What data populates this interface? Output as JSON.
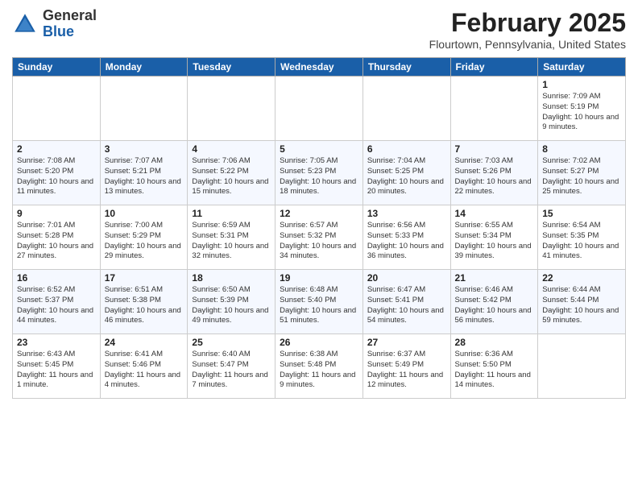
{
  "header": {
    "logo_general": "General",
    "logo_blue": "Blue",
    "month_title": "February 2025",
    "location": "Flourtown, Pennsylvania, United States"
  },
  "days_of_week": [
    "Sunday",
    "Monday",
    "Tuesday",
    "Wednesday",
    "Thursday",
    "Friday",
    "Saturday"
  ],
  "weeks": [
    [
      {
        "day": "",
        "info": ""
      },
      {
        "day": "",
        "info": ""
      },
      {
        "day": "",
        "info": ""
      },
      {
        "day": "",
        "info": ""
      },
      {
        "day": "",
        "info": ""
      },
      {
        "day": "",
        "info": ""
      },
      {
        "day": "1",
        "info": "Sunrise: 7:09 AM\nSunset: 5:19 PM\nDaylight: 10 hours and 9 minutes."
      }
    ],
    [
      {
        "day": "2",
        "info": "Sunrise: 7:08 AM\nSunset: 5:20 PM\nDaylight: 10 hours and 11 minutes."
      },
      {
        "day": "3",
        "info": "Sunrise: 7:07 AM\nSunset: 5:21 PM\nDaylight: 10 hours and 13 minutes."
      },
      {
        "day": "4",
        "info": "Sunrise: 7:06 AM\nSunset: 5:22 PM\nDaylight: 10 hours and 15 minutes."
      },
      {
        "day": "5",
        "info": "Sunrise: 7:05 AM\nSunset: 5:23 PM\nDaylight: 10 hours and 18 minutes."
      },
      {
        "day": "6",
        "info": "Sunrise: 7:04 AM\nSunset: 5:25 PM\nDaylight: 10 hours and 20 minutes."
      },
      {
        "day": "7",
        "info": "Sunrise: 7:03 AM\nSunset: 5:26 PM\nDaylight: 10 hours and 22 minutes."
      },
      {
        "day": "8",
        "info": "Sunrise: 7:02 AM\nSunset: 5:27 PM\nDaylight: 10 hours and 25 minutes."
      }
    ],
    [
      {
        "day": "9",
        "info": "Sunrise: 7:01 AM\nSunset: 5:28 PM\nDaylight: 10 hours and 27 minutes."
      },
      {
        "day": "10",
        "info": "Sunrise: 7:00 AM\nSunset: 5:29 PM\nDaylight: 10 hours and 29 minutes."
      },
      {
        "day": "11",
        "info": "Sunrise: 6:59 AM\nSunset: 5:31 PM\nDaylight: 10 hours and 32 minutes."
      },
      {
        "day": "12",
        "info": "Sunrise: 6:57 AM\nSunset: 5:32 PM\nDaylight: 10 hours and 34 minutes."
      },
      {
        "day": "13",
        "info": "Sunrise: 6:56 AM\nSunset: 5:33 PM\nDaylight: 10 hours and 36 minutes."
      },
      {
        "day": "14",
        "info": "Sunrise: 6:55 AM\nSunset: 5:34 PM\nDaylight: 10 hours and 39 minutes."
      },
      {
        "day": "15",
        "info": "Sunrise: 6:54 AM\nSunset: 5:35 PM\nDaylight: 10 hours and 41 minutes."
      }
    ],
    [
      {
        "day": "16",
        "info": "Sunrise: 6:52 AM\nSunset: 5:37 PM\nDaylight: 10 hours and 44 minutes."
      },
      {
        "day": "17",
        "info": "Sunrise: 6:51 AM\nSunset: 5:38 PM\nDaylight: 10 hours and 46 minutes."
      },
      {
        "day": "18",
        "info": "Sunrise: 6:50 AM\nSunset: 5:39 PM\nDaylight: 10 hours and 49 minutes."
      },
      {
        "day": "19",
        "info": "Sunrise: 6:48 AM\nSunset: 5:40 PM\nDaylight: 10 hours and 51 minutes."
      },
      {
        "day": "20",
        "info": "Sunrise: 6:47 AM\nSunset: 5:41 PM\nDaylight: 10 hours and 54 minutes."
      },
      {
        "day": "21",
        "info": "Sunrise: 6:46 AM\nSunset: 5:42 PM\nDaylight: 10 hours and 56 minutes."
      },
      {
        "day": "22",
        "info": "Sunrise: 6:44 AM\nSunset: 5:44 PM\nDaylight: 10 hours and 59 minutes."
      }
    ],
    [
      {
        "day": "23",
        "info": "Sunrise: 6:43 AM\nSunset: 5:45 PM\nDaylight: 11 hours and 1 minute."
      },
      {
        "day": "24",
        "info": "Sunrise: 6:41 AM\nSunset: 5:46 PM\nDaylight: 11 hours and 4 minutes."
      },
      {
        "day": "25",
        "info": "Sunrise: 6:40 AM\nSunset: 5:47 PM\nDaylight: 11 hours and 7 minutes."
      },
      {
        "day": "26",
        "info": "Sunrise: 6:38 AM\nSunset: 5:48 PM\nDaylight: 11 hours and 9 minutes."
      },
      {
        "day": "27",
        "info": "Sunrise: 6:37 AM\nSunset: 5:49 PM\nDaylight: 11 hours and 12 minutes."
      },
      {
        "day": "28",
        "info": "Sunrise: 6:36 AM\nSunset: 5:50 PM\nDaylight: 11 hours and 14 minutes."
      },
      {
        "day": "",
        "info": ""
      }
    ]
  ]
}
